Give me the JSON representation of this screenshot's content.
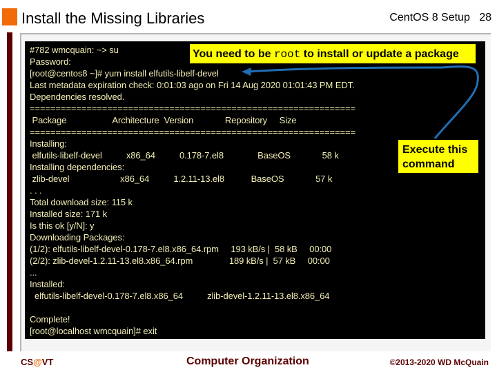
{
  "slide": {
    "title": "Install the Missing Libraries",
    "section": "CentOS 8 Setup",
    "page_number": "28",
    "accent_color": "#f26b0a",
    "brand_color": "#5a0000"
  },
  "terminal": {
    "lines": [
      "#782 wmcquain: ~> su",
      "Password:",
      "[root@centos8 ~]# yum install elfutils-libelf-devel",
      "Last metadata expiration check: 0:01:03 ago on Fri 14 Aug 2020 01:01:43 PM EDT.",
      "Dependencies resolved.",
      "===============================================================",
      " Package                   Architecture  Version             Repository     Size",
      "===============================================================",
      "Installing:",
      " elfutils-libelf-devel          x86_64          0.178-7.el8              BaseOS             58 k",
      "Installing dependencies:",
      " zlib-devel                     x86_64          1.2.11-13.el8           BaseOS             57 k",
      ". . .",
      "Total download size: 115 k",
      "Installed size: 171 k",
      "Is this ok [y/N]: y",
      "Downloading Packages:",
      "(1/2): elfutils-libelf-devel-0.178-7.el8.x86_64.rpm     193 kB/s |  58 kB     00:00",
      "(2/2): zlib-devel-1.2.11-13.el8.x86_64.rpm               189 kB/s |  57 kB     00:00",
      "...",
      "Installed:",
      "  elfutils-libelf-devel-0.178-7.el8.x86_64          zlib-devel-1.2.11-13.el8.x86_64",
      "",
      "Complete!",
      "[root@localhost wmcquain]# exit"
    ]
  },
  "callouts": {
    "root_prefix": "You need to be ",
    "root_code": "root",
    "root_suffix": " to install or update a package",
    "execute_line1": "Execute this",
    "execute_line2": "command",
    "arrow_color": "#1f6fb4"
  },
  "footer": {
    "left_cs": "CS",
    "left_at": "@",
    "left_vt": "VT",
    "center": "Computer Organization",
    "right": "©2013-2020 WD McQuain"
  }
}
